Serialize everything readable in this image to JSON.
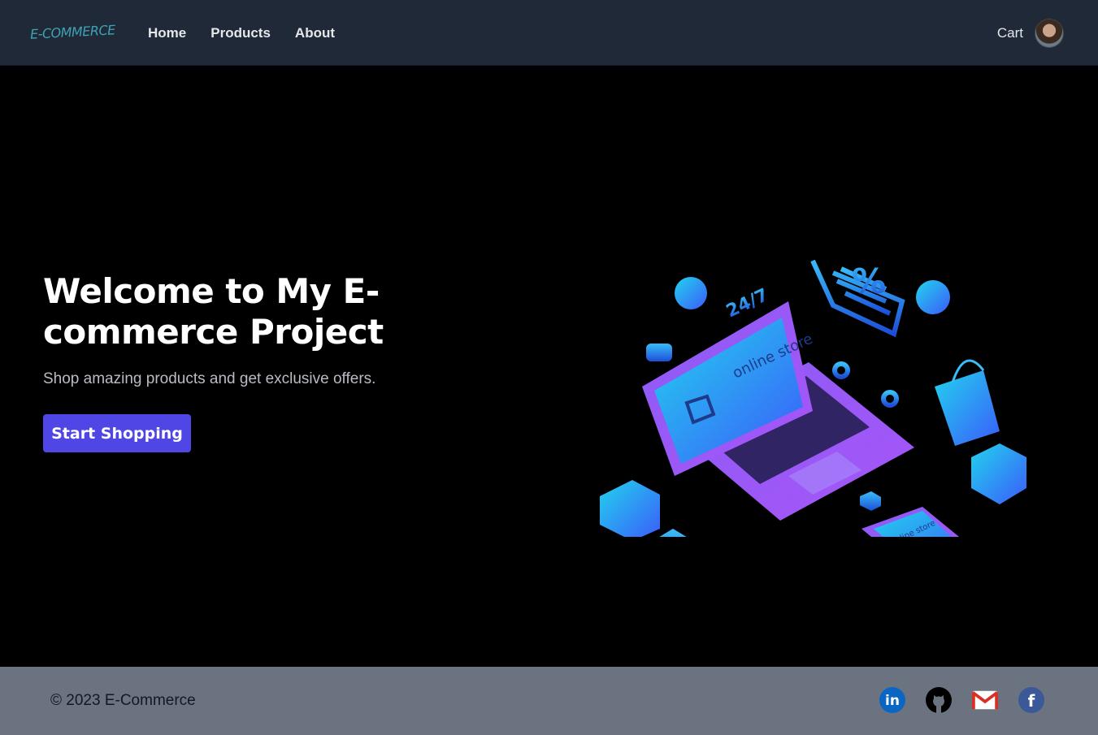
{
  "navbar": {
    "brand": "E-COMMERCE",
    "links": [
      {
        "label": "Home"
      },
      {
        "label": "Products"
      },
      {
        "label": "About"
      }
    ],
    "cart_label": "Cart"
  },
  "hero": {
    "title": "Welcome to My E-commerce Project",
    "subtitle": "Shop amazing products and get exclusive offers.",
    "cta_label": "Start Shopping",
    "illustration_text_laptop": "online store",
    "illustration_text_phone": "online store",
    "illustration_text_247": "24/7",
    "illustration_text_percent": "%"
  },
  "footer": {
    "copyright": "© 2023 E-Commerce",
    "socials": [
      {
        "icon": "linkedin-icon",
        "label": "in"
      },
      {
        "icon": "github-icon"
      },
      {
        "icon": "gmail-icon"
      },
      {
        "icon": "facebook-icon",
        "label": "f"
      }
    ]
  },
  "colors": {
    "navbar_bg": "#1f2937",
    "brand": "#3fa3b3",
    "hero_bg": "#000000",
    "cta": "#4f46e5",
    "footer_bg": "#6b7280"
  }
}
